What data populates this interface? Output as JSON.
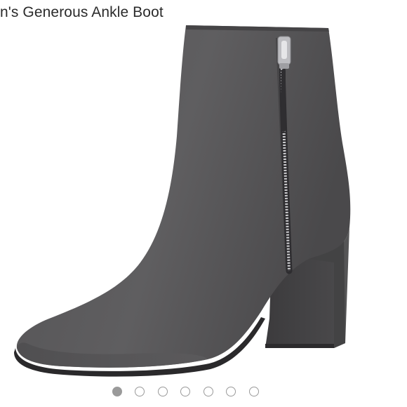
{
  "product": {
    "title": "n's Generous Ankle Boot",
    "image": {
      "icon": "ankle-boot-photo",
      "colors": {
        "suede": "#5b5a5b",
        "suede_dark": "#3f3e40",
        "sole": "#2a292b",
        "zipper": "#c9c9cc"
      }
    }
  },
  "carousel": {
    "count": 7,
    "active_index": 0,
    "dot_color": "#9a9a9a"
  }
}
